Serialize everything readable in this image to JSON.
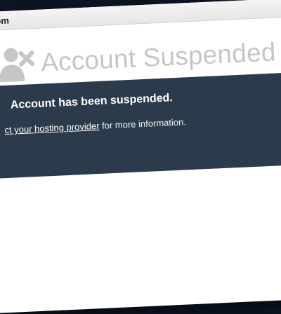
{
  "browser": {
    "address_text": "om"
  },
  "page": {
    "title": "Account Suspended",
    "notice_heading": "Account has been suspended.",
    "contact_link_text": "ct your hosting provider",
    "contact_suffix": " for more information."
  },
  "icons": {
    "header_icon": "user-x-icon"
  },
  "colors": {
    "notice_background": "#2c3b4b",
    "title_text": "#c6c6c6",
    "icon_gray": "#c6c6c6"
  }
}
